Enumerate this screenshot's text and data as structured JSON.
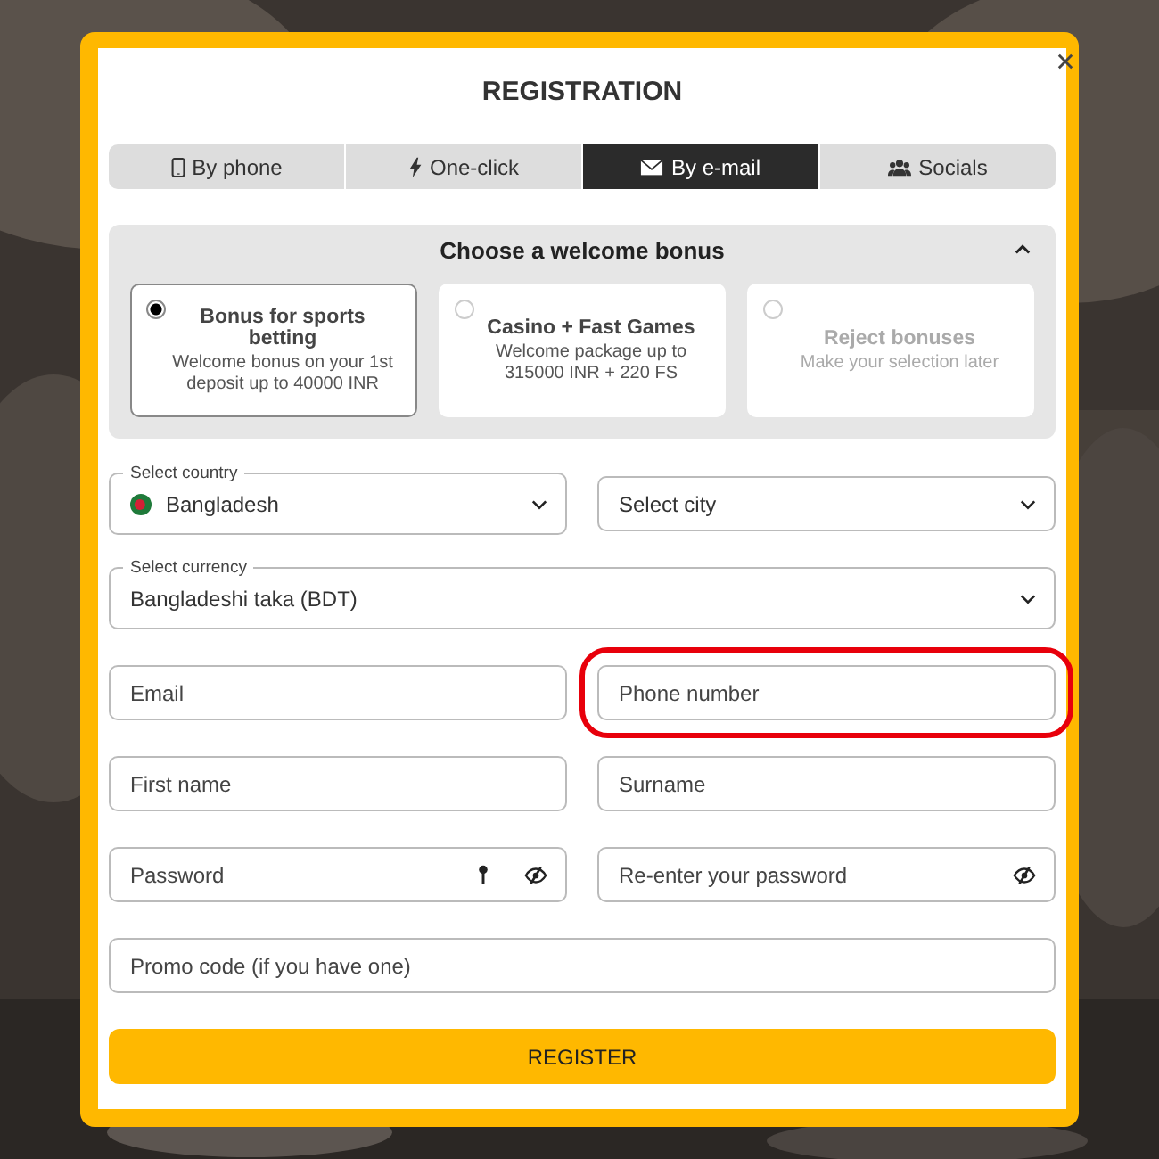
{
  "title": "REGISTRATION",
  "tabs": [
    {
      "label": "By phone",
      "kind": "phone",
      "selected": false
    },
    {
      "label": "One-click",
      "kind": "bolt",
      "selected": false
    },
    {
      "label": "By e-mail",
      "kind": "mail",
      "selected": true
    },
    {
      "label": "Socials",
      "kind": "users",
      "selected": false
    }
  ],
  "bonus": {
    "title": "Choose a welcome bonus",
    "expanded": true,
    "options": [
      {
        "title": "Bonus for sports betting",
        "description": "Welcome bonus on your 1st deposit up to 40000 INR",
        "selected": true,
        "disabled": false
      },
      {
        "title": "Casino + Fast Games",
        "description": "Welcome package up to 315000 INR + 220 FS",
        "selected": false,
        "disabled": false
      },
      {
        "title": "Reject bonuses",
        "description": "Make your selection later",
        "selected": false,
        "disabled": true
      }
    ]
  },
  "form_rows": [
    [
      {
        "kind": "country",
        "label": "Select country",
        "value": "Bangladesh"
      },
      {
        "kind": "select",
        "placeholder": "Select city"
      }
    ],
    [
      {
        "kind": "labeled-select",
        "label": "Select currency",
        "value": "Bangladeshi taka (BDT)"
      }
    ],
    [
      {
        "kind": "input",
        "placeholder": "Email"
      },
      {
        "kind": "input",
        "placeholder": "Phone number",
        "highlighted": true
      }
    ],
    [
      {
        "kind": "input",
        "placeholder": "First name"
      },
      {
        "kind": "input",
        "placeholder": "Surname"
      }
    ],
    [
      {
        "kind": "password",
        "placeholder": "Password",
        "generator": true
      },
      {
        "kind": "password",
        "placeholder": "Re-enter your password",
        "generator": false
      }
    ],
    [
      {
        "kind": "input",
        "placeholder": "Promo code (if you have one)"
      }
    ]
  ],
  "submit": "REGISTER"
}
